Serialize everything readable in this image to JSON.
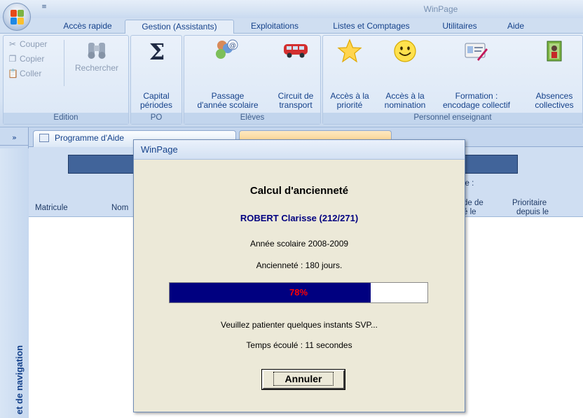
{
  "app": {
    "title": "WinPage",
    "qat_glyph": "≡"
  },
  "ribbon_tabs": [
    {
      "label": "Accès rapide",
      "active": false
    },
    {
      "label": "Gestion (Assistants)",
      "active": true
    },
    {
      "label": "Exploitations",
      "active": false
    },
    {
      "label": "Listes et Comptages",
      "active": false
    },
    {
      "label": "Utilitaires",
      "active": false
    },
    {
      "label": "Aide",
      "active": false
    }
  ],
  "ribbon": {
    "edition": {
      "label": "Edition",
      "couper": "Couper",
      "copier": "Copier",
      "coller": "Coller",
      "rechercher": "Rechercher"
    },
    "po": {
      "label": "PO",
      "capital_l1": "Capital",
      "capital_l2": "périodes"
    },
    "eleves": {
      "label": "Elèves",
      "passage_l1": "Passage",
      "passage_l2": "d'année scolaire",
      "circuit_l1": "Circuit de",
      "circuit_l2": "transport"
    },
    "personnel": {
      "label": "Personnel enseignant",
      "acces_prio_l1": "Accès à la",
      "acces_prio_l2": "priorité",
      "acces_nom_l1": "Accès à la",
      "acces_nom_l2": "nomination",
      "formation_l1": "Formation :",
      "formation_l2": "encodage collectif",
      "absences_l1": "Absences",
      "absences_l2": "collectives"
    }
  },
  "nav_pane": {
    "chevron": "»",
    "label": "et de navigation"
  },
  "doc_tabs": {
    "tab1": "Programme d'Aide"
  },
  "form_header": {
    "col_matricule": "Matricule",
    "col_nom": "Nom",
    "le_label": "le :",
    "de_de_l1": "de de",
    "de_de_l2": "é le",
    "prio_l1": "Prioritaire",
    "prio_l2": "depuis le"
  },
  "dialog": {
    "title": "WinPage",
    "heading": "Calcul d'ancienneté",
    "person": "ROBERT Clarisse (212/271)",
    "school_year": "Année scolaire 2008-2009",
    "seniority": "Ancienneté :  180 jours.",
    "progress_label": "78%",
    "progress": 0.78,
    "wait_message": "Veuillez patienter quelques instants SVP...",
    "elapsed": "Temps écoulé : 11 secondes",
    "cancel": "Annuler"
  }
}
